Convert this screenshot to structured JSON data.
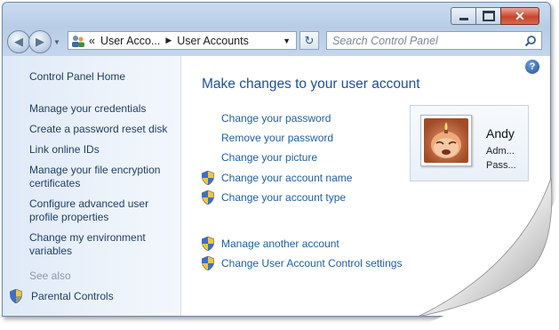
{
  "window": {
    "caption": {
      "minimize_icon": "minimize-icon",
      "maximize_icon": "maximize-icon",
      "close_glyph": "✕"
    }
  },
  "navigation": {
    "back_icon": "back-arrow-icon",
    "forward_icon": "forward-arrow-icon",
    "address": {
      "overflow": "«",
      "crumb1": "User Acco...",
      "crumb2": "User Accounts"
    },
    "search_placeholder": "Search Control Panel"
  },
  "sidebar": {
    "home": "Control Panel Home",
    "links": [
      "Manage your credentials",
      "Create a password reset disk",
      "Link online IDs",
      "Manage your file encryption certificates",
      "Configure advanced user profile properties",
      "Change my environment variables"
    ],
    "see_also": "See also",
    "parental_controls": "Parental Controls"
  },
  "main": {
    "title": "Make changes to your user account",
    "tasks": [
      "Change your password",
      "Remove your password",
      "Change your picture",
      "Change your account name",
      "Change your account type"
    ],
    "other_tasks": [
      "Manage another account",
      "Change User Account Control settings"
    ],
    "help_glyph": "?"
  },
  "account": {
    "name": "Andy",
    "type": "Adm...",
    "password_status": "Pass..."
  },
  "colors": {
    "link": "#1e5fa6",
    "title": "#1e4ea1",
    "chrome": "#c4d6ec"
  }
}
